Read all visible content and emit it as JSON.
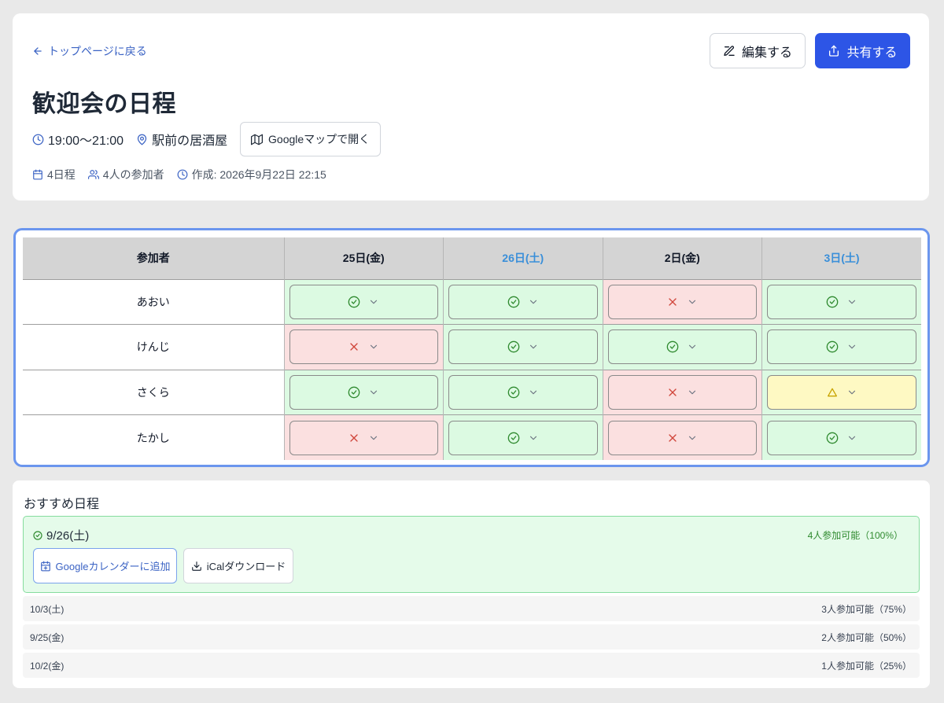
{
  "header": {
    "back_label": "トップページに戻る",
    "edit_label": "編集する",
    "share_label": "共有する",
    "title": "歓迎会の日程",
    "time": "19:00〜21:00",
    "place": "駅前の居酒屋",
    "map_label": "Googleマップで開く",
    "meta": {
      "dates": "4日程",
      "participants": "4人の参加者",
      "created": "作成: 2026年9月22日 22:15"
    }
  },
  "schedule": {
    "name_header": "参加者",
    "dates": [
      {
        "label": "25日(金)",
        "saturday": false
      },
      {
        "label": "26日(土)",
        "saturday": true
      },
      {
        "label": "2日(金)",
        "saturday": false
      },
      {
        "label": "3日(土)",
        "saturday": true
      }
    ],
    "rows": [
      {
        "name": "あおい",
        "answers": [
          "ok",
          "ok",
          "ng",
          "ok"
        ]
      },
      {
        "name": "けんじ",
        "answers": [
          "ng",
          "ok",
          "ok",
          "ok"
        ]
      },
      {
        "name": "さくら",
        "answers": [
          "ok",
          "ok",
          "ng",
          "maybe"
        ]
      },
      {
        "name": "たかし",
        "answers": [
          "ng",
          "ok",
          "ng",
          "ok"
        ]
      }
    ]
  },
  "recommend": {
    "title": "おすすめ日程",
    "best": {
      "date": "9/26(土)",
      "count": "4人参加可能（100%）",
      "gcal_label": "Googleカレンダーに追加",
      "ical_label": "iCalダウンロード"
    },
    "others": [
      {
        "date": "10/3(土)",
        "count": "3人参加可能（75%）"
      },
      {
        "date": "9/25(金)",
        "count": "2人参加可能（50%）"
      },
      {
        "date": "10/2(金)",
        "count": "1人参加可能（25%）"
      }
    ]
  },
  "colors": {
    "accent": "#2d55e6",
    "ok": "#dcfae2",
    "ng": "#fbe0e0",
    "maybe": "#fef9c3",
    "saturday": "#3a8fd9"
  }
}
